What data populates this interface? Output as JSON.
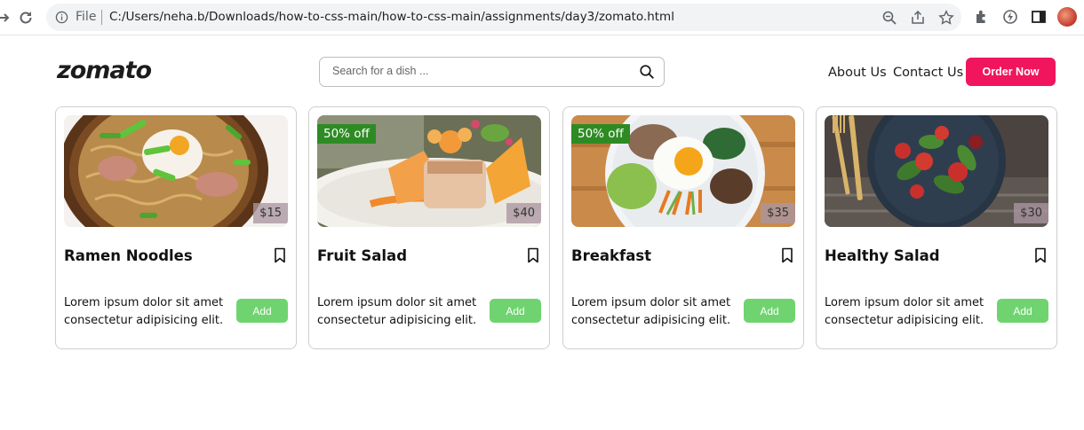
{
  "browser": {
    "info_label": "File",
    "url": "C:/Users/neha.b/Downloads/how-to-css-main/how-to-css-main/assignments/day3/zomato.html"
  },
  "header": {
    "logo": "zomato",
    "search_placeholder": "Search for a dish ...",
    "nav": {
      "about": "About Us",
      "contact": "Contact Us"
    },
    "order_button": "Order Now"
  },
  "cards": [
    {
      "title": "Ramen Noodles",
      "price": "$15",
      "badge": "",
      "description": "Lorem ipsum dolor sit amet consectetur adipisicing elit.",
      "button": "Add"
    },
    {
      "title": "Fruit Salad",
      "price": "$40",
      "badge": "50% off",
      "description": "Lorem ipsum dolor sit amet consectetur adipisicing elit.",
      "button": "Add"
    },
    {
      "title": "Breakfast",
      "price": "$35",
      "badge": "50% off",
      "description": "Lorem ipsum dolor sit amet consectetur adipisicing elit.",
      "button": "Add"
    },
    {
      "title": "Healthy Salad",
      "price": "$30",
      "badge": "",
      "description": "Lorem ipsum dolor sit amet consectetur adipisicing elit.",
      "button": "Add"
    }
  ],
  "colors": {
    "brand": "#f0155d",
    "add_button": "#6fd46f",
    "discount_badge": "#2e8b24"
  }
}
